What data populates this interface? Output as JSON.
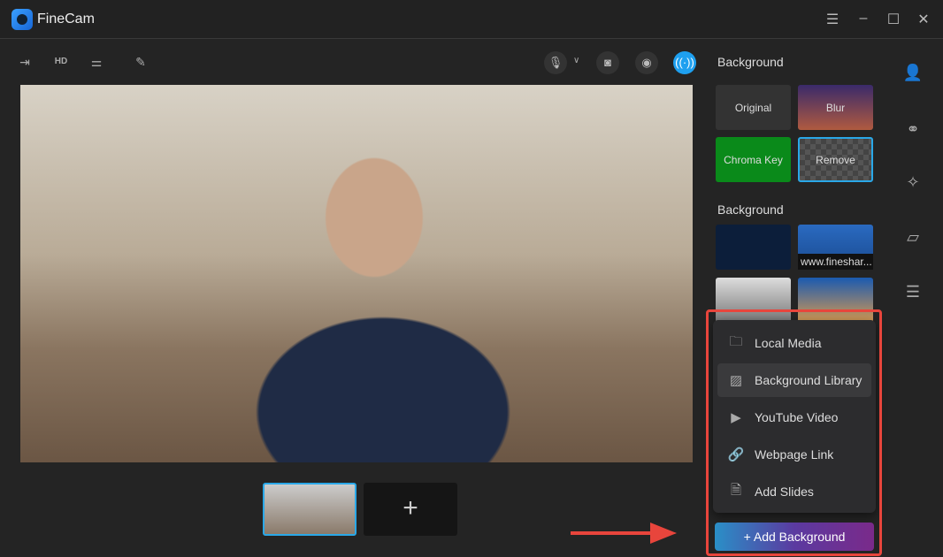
{
  "app": {
    "title": "FineCam"
  },
  "window": {
    "icons": [
      "menu-icon",
      "minimize-icon",
      "maximize-icon",
      "close-icon"
    ]
  },
  "toolbar": {
    "icons": [
      "exit-icon",
      "hd-icon",
      "adjust-icon",
      "annotate-icon",
      "mic-icon",
      "camera-icon",
      "record-icon",
      "broadcast-icon"
    ]
  },
  "panel": {
    "section1": "Background",
    "modes": [
      "Original",
      "Blur",
      "Chroma Key",
      "Remove"
    ],
    "section2": "Background",
    "bg_items": [
      "",
      "www.fineshar..."
    ]
  },
  "menu": {
    "items": [
      {
        "label": "Local Media",
        "icon": "folder-icon"
      },
      {
        "label": "Background Library",
        "icon": "image-icon"
      },
      {
        "label": "YouTube Video",
        "icon": "play-icon"
      },
      {
        "label": "Webpage Link",
        "icon": "link-icon"
      },
      {
        "label": "Add Slides",
        "icon": "slides-icon"
      }
    ]
  },
  "add_background": "+ Add Background",
  "add_scene": "+",
  "colors": {
    "accent": "#2aa8e8",
    "annotation": "#e8453c",
    "chroma": "#0a8a1a"
  }
}
